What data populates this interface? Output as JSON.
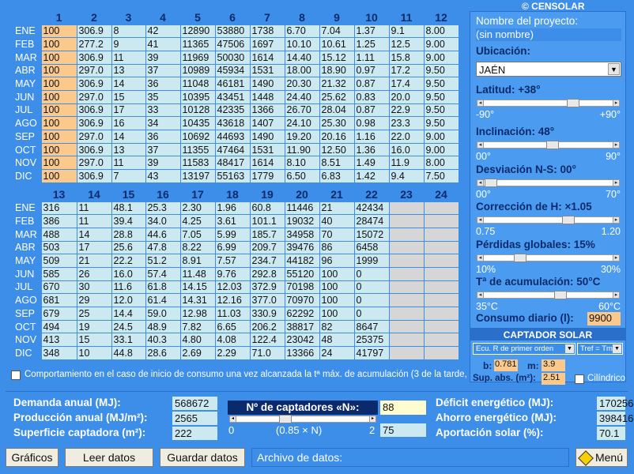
{
  "brand": "© CENSOLAR",
  "table1": {
    "headers": [
      "1",
      "2",
      "3",
      "4",
      "5",
      "6",
      "7",
      "8",
      "9",
      "10",
      "11",
      "12"
    ],
    "rows": [
      {
        "m": "ENE",
        "v": [
          "100",
          "306.9",
          "8",
          "42",
          "12890",
          "53880",
          "1738",
          "6.70",
          "7.04",
          "1.37",
          "9.1",
          "8.00"
        ]
      },
      {
        "m": "FEB",
        "v": [
          "100",
          "277.2",
          "9",
          "41",
          "11365",
          "47506",
          "1697",
          "10.10",
          "10.61",
          "1.25",
          "12.5",
          "9.00"
        ]
      },
      {
        "m": "MAR",
        "v": [
          "100",
          "306.9",
          "11",
          "39",
          "11969",
          "50030",
          "1614",
          "14.40",
          "15.12",
          "1.11",
          "15.8",
          "9.00"
        ]
      },
      {
        "m": "ABR",
        "v": [
          "100",
          "297.0",
          "13",
          "37",
          "10989",
          "45934",
          "1531",
          "18.00",
          "18.90",
          "0.97",
          "17.2",
          "9.50"
        ]
      },
      {
        "m": "MAY",
        "v": [
          "100",
          "306.9",
          "14",
          "36",
          "11048",
          "46181",
          "1490",
          "20.30",
          "21.32",
          "0.87",
          "17.4",
          "9.50"
        ]
      },
      {
        "m": "JUN",
        "v": [
          "100",
          "297.0",
          "15",
          "35",
          "10395",
          "43451",
          "1448",
          "24.40",
          "25.62",
          "0.83",
          "20.0",
          "9.50"
        ]
      },
      {
        "m": "JUL",
        "v": [
          "100",
          "306.9",
          "17",
          "33",
          "10128",
          "42335",
          "1366",
          "26.70",
          "28.04",
          "0.87",
          "22.9",
          "9.50"
        ]
      },
      {
        "m": "AGO",
        "v": [
          "100",
          "306.9",
          "16",
          "34",
          "10435",
          "43618",
          "1407",
          "24.10",
          "25.30",
          "0.98",
          "23.3",
          "9.50"
        ]
      },
      {
        "m": "SEP",
        "v": [
          "100",
          "297.0",
          "14",
          "36",
          "10692",
          "44693",
          "1490",
          "19.20",
          "20.16",
          "1.16",
          "22.0",
          "9.00"
        ]
      },
      {
        "m": "OCT",
        "v": [
          "100",
          "306.9",
          "13",
          "37",
          "11355",
          "47464",
          "1531",
          "11.90",
          "12.50",
          "1.36",
          "16.0",
          "9.00"
        ]
      },
      {
        "m": "NOV",
        "v": [
          "100",
          "297.0",
          "11",
          "39",
          "11583",
          "48417",
          "1614",
          "8.10",
          "8.51",
          "1.49",
          "11.9",
          "8.00"
        ]
      },
      {
        "m": "DIC",
        "v": [
          "100",
          "306.9",
          "7",
          "43",
          "13197",
          "55163",
          "1779",
          "6.50",
          "6.83",
          "1.42",
          "9.4",
          "7.50"
        ]
      }
    ]
  },
  "table2": {
    "headers": [
      "13",
      "14",
      "15",
      "16",
      "17",
      "18",
      "19",
      "20",
      "21",
      "22",
      "23",
      "24"
    ],
    "rows": [
      {
        "m": "ENE",
        "v": [
          "316",
          "11",
          "48.1",
          "25.3",
          "2.30",
          "1.96",
          "60.8",
          "11446",
          "21",
          "42434",
          "",
          ""
        ]
      },
      {
        "m": "FEB",
        "v": [
          "386",
          "11",
          "39.4",
          "34.0",
          "4.25",
          "3.61",
          "101.1",
          "19032",
          "40",
          "28474",
          "",
          ""
        ]
      },
      {
        "m": "MAR",
        "v": [
          "488",
          "14",
          "28.8",
          "44.6",
          "7.05",
          "5.99",
          "185.7",
          "34958",
          "70",
          "15072",
          "",
          ""
        ]
      },
      {
        "m": "ABR",
        "v": [
          "503",
          "17",
          "25.6",
          "47.8",
          "8.22",
          "6.99",
          "209.7",
          "39476",
          "86",
          "6458",
          "",
          ""
        ]
      },
      {
        "m": "MAY",
        "v": [
          "509",
          "21",
          "22.2",
          "51.2",
          "8.91",
          "7.57",
          "234.7",
          "44182",
          "96",
          "1999",
          "",
          ""
        ]
      },
      {
        "m": "JUN",
        "v": [
          "585",
          "26",
          "16.0",
          "57.4",
          "11.48",
          "9.76",
          "292.8",
          "55120",
          "100",
          "0",
          "",
          ""
        ]
      },
      {
        "m": "JUL",
        "v": [
          "670",
          "30",
          "11.6",
          "61.8",
          "14.15",
          "12.03",
          "372.9",
          "70198",
          "100",
          "0",
          "",
          ""
        ]
      },
      {
        "m": "AGO",
        "v": [
          "681",
          "29",
          "12.0",
          "61.4",
          "14.31",
          "12.16",
          "377.0",
          "70970",
          "100",
          "0",
          "",
          ""
        ]
      },
      {
        "m": "SEP",
        "v": [
          "679",
          "25",
          "14.4",
          "59.0",
          "12.98",
          "11.03",
          "330.9",
          "62292",
          "100",
          "0",
          "",
          ""
        ]
      },
      {
        "m": "OCT",
        "v": [
          "494",
          "19",
          "24.5",
          "48.9",
          "7.82",
          "6.65",
          "206.2",
          "38817",
          "82",
          "8647",
          "",
          ""
        ]
      },
      {
        "m": "NOV",
        "v": [
          "413",
          "15",
          "33.1",
          "40.3",
          "4.80",
          "4.08",
          "122.4",
          "23042",
          "48",
          "25375",
          "",
          ""
        ]
      },
      {
        "m": "DIC",
        "v": [
          "348",
          "10",
          "44.8",
          "28.6",
          "2.69",
          "2.29",
          "71.0",
          "13366",
          "24",
          "41797",
          "",
          ""
        ]
      }
    ]
  },
  "checkbox_label": "Comportamiento en el caso de inicio de consumo una vez alcanzada la tª máx. de acumulación (3 de la tarde, aprox.)",
  "panel": {
    "project_label": "Nombre del proyecto:",
    "project_value": "(sin nombre)",
    "location_label": "Ubicación:",
    "location_value": "JAÉN",
    "latitude": {
      "label": "Latitud: +38°",
      "min": "-90°",
      "max": "+90°",
      "fraction": 0.71
    },
    "inclination": {
      "label": "Inclinación: 48°",
      "min": "00°",
      "max": "90°",
      "fraction": 0.53
    },
    "deviation": {
      "label": "Desviación N-S: 00°",
      "min": "00°",
      "max": "70°",
      "fraction": 0.0
    },
    "correction": {
      "label": "Corrección de H: ×1.05",
      "min": "0.75",
      "max": "1.20",
      "fraction": 0.67
    },
    "losses": {
      "label": "Pérdidas globales: 15%",
      "min": "10%",
      "max": "30%",
      "fraction": 0.25
    },
    "temperature": {
      "label": "Tª de acumulación: 50°C",
      "min": "35°C",
      "max": "60°C",
      "fraction": 0.6
    },
    "daily_label": "Consumo diario (l):",
    "daily_value": "9900",
    "collector_header": "CAPTADOR SOLAR",
    "ecu_select": "Ecu. R de primer orden",
    "tref_select": "Tref = Tm",
    "b_label": "b:",
    "b_value": "0.781",
    "m_label": "m:",
    "m_value": "3.9",
    "sup_label": "Sup. abs. (m²):",
    "sup_value": "2.51",
    "cyl_label": "Cilíndrico"
  },
  "bottom": {
    "demand_label": "Demanda anual (MJ):",
    "demand_value": "568672",
    "production_label": "Producción anual (MJ/m²):",
    "production_value": "2565",
    "surface_label": "Superficie captadora (m²):",
    "surface_value": "222",
    "collectors_label": "Nº de captadores «N»:",
    "collectors_value": "88",
    "collectors_fraction": 0.35,
    "collectors_min": "0",
    "collectors_formula": "(0.85 × N)",
    "collectors_max": "2",
    "collectors_max_value": "75",
    "deficit_label": "Déficit energético (MJ):",
    "deficit_value": "170256",
    "saving_label": "Ahorro energético (MJ):",
    "saving_value": "398416",
    "solar_label": "Aportación solar (%):",
    "solar_value": "70.1"
  },
  "buttons": {
    "graphs": "Gráficos",
    "read": "Leer datos",
    "save": "Guardar datos",
    "file_label": "Archivo de datos:",
    "menu": "Menú"
  },
  "colors": {
    "bg": "#3d8ee8",
    "cell": "#cce9f1",
    "highlight": "#fbc98c"
  }
}
